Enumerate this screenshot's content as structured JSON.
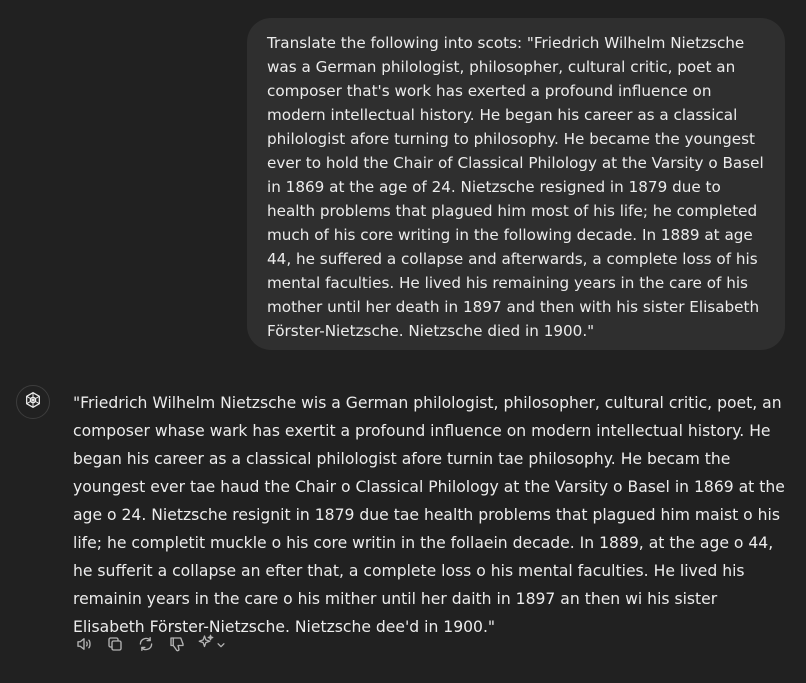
{
  "conversation": {
    "user_message": "Translate the following into scots: \"Friedrich Wilhelm Nietzsche  was a German philologist, philosopher, cultural critic, poet an composer that's work has exerted a profound influence on modern intellectual history. He began his career as a classical philologist afore turning to philosophy. He became the youngest ever to hold the Chair of Classical Philology at the Varsity o Basel in 1869 at the age of 24. Nietzsche resigned in 1879 due to health problems that plagued him most of his life; he completed much of his core writing in the following decade. In 1889 at age 44, he suffered a collapse and afterwards, a complete loss of his mental faculties. He lived his remaining years in the care of his mother until her death in 1897 and then with his sister Elisabeth Förster-Nietzsche. Nietzsche died in 1900.\"",
    "assistant_message": "\"Friedrich Wilhelm Nietzsche wis a German philologist, philosopher, cultural critic, poet, an composer whase wark has exertit a profound influence on modern intellectual history. He began his career as a classical philologist afore turnin tae philosophy. He becam the youngest ever tae haud the Chair o Classical Philology at the Varsity o Basel in 1869 at the age o 24. Nietzsche resignit in 1879 due tae health problems that plagued him maist o his life; he completit muckle o his core writin in the follaein decade. In 1889, at the age o 44, he sufferit a collapse an efter that, a complete loss o his mental faculties. He lived his remainin years in the care o his mither until her daith in 1897 an then wi his sister Elisabeth Förster-Nietzsche. Nietzsche dee'd in 1900.\""
  },
  "actions": {
    "icons": [
      "read-aloud-icon",
      "copy-icon",
      "regenerate-icon",
      "thumbs-down-icon",
      "sparkle-icon",
      "chevron-down-icon"
    ]
  },
  "colors": {
    "background": "#212121",
    "user_bubble": "#2f2f2f",
    "text": "#ececec",
    "icon": "#b4b4b4"
  }
}
